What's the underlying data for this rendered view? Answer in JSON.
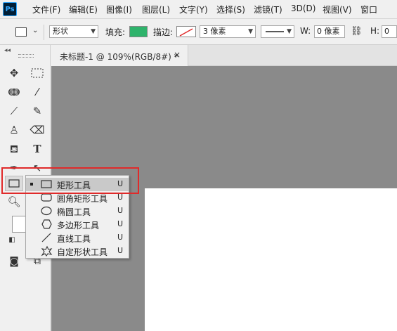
{
  "app": {
    "logo": "Ps"
  },
  "menubar": {
    "items": [
      "文件(F)",
      "编辑(E)",
      "图像(I)",
      "图层(L)",
      "文字(Y)",
      "选择(S)",
      "滤镜(T)",
      "3D(D)",
      "视图(V)",
      "窗口"
    ]
  },
  "options_bar": {
    "tool_mode": "形状",
    "fill_label": "填充:",
    "fill_color": "#2eb36b",
    "stroke_label": "描边:",
    "stroke_width": "3 像素",
    "w_label": "W:",
    "w_value": "0 像素",
    "h_label": "H:",
    "h_value": "0"
  },
  "document": {
    "tab_title": "未标题-1 @ 109%(RGB/8#) *",
    "close": "×"
  },
  "shape_flyout": {
    "items": [
      {
        "label": "矩形工具",
        "shortcut": "U",
        "icon": "rectangle-icon",
        "selected": true
      },
      {
        "label": "圆角矩形工具",
        "shortcut": "U",
        "icon": "rounded-rectangle-icon",
        "selected": false
      },
      {
        "label": "椭圆工具",
        "shortcut": "U",
        "icon": "ellipse-icon",
        "selected": false
      },
      {
        "label": "多边形工具",
        "shortcut": "U",
        "icon": "polygon-icon",
        "selected": false
      },
      {
        "label": "直线工具",
        "shortcut": "U",
        "icon": "line-icon",
        "selected": false
      },
      {
        "label": "自定形状工具",
        "shortcut": "U",
        "icon": "custom-shape-icon",
        "selected": false
      }
    ]
  },
  "colors": {
    "highlight": "#e02a2a",
    "pasteboard": "#8a8a8a",
    "canvas": "#ffffff"
  }
}
